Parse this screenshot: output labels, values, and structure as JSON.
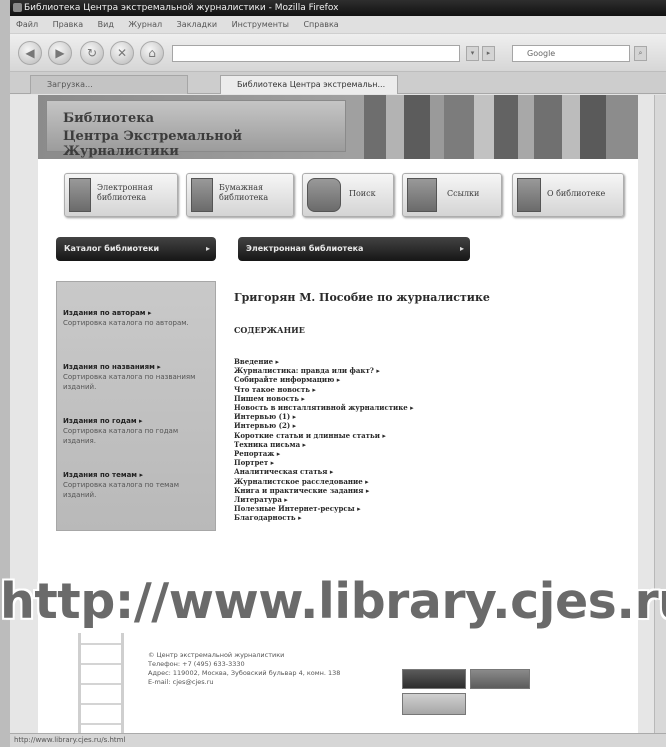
{
  "browser": {
    "window_title": "Библиотека Центра экстремальной журналистики - Mozilla Firefox",
    "menu": [
      "Файл",
      "Правка",
      "Вид",
      "Журнал",
      "Закладки",
      "Инструменты",
      "Справка"
    ],
    "address": "",
    "search_placeholder": "Google",
    "tabs": [
      {
        "label": "Загрузка..."
      },
      {
        "label": "Библиотека Центра экстремальн..."
      }
    ],
    "status_text": "http://www.library.cjes.ru/s.html"
  },
  "site": {
    "title_line1": "Библиотека",
    "title_line2": "Центра Экстремальной Журналистики",
    "nav": [
      {
        "label": "Электронная библиотека",
        "icon": "book-icon"
      },
      {
        "label": "Бумажная библиотека",
        "icon": "bookshelf-icon"
      },
      {
        "label": "Поиск",
        "icon": "scroll-icon"
      },
      {
        "label": "Ссылки",
        "icon": "signpost-icon"
      },
      {
        "label": "О библиотеке",
        "icon": "scroll-paper-icon"
      }
    ],
    "left_header": "Каталог библиотеки",
    "main_header": "Электронная библиотека",
    "sidebar": [
      {
        "title": "Издания по авторам ▸",
        "desc": "Сортировка каталога по авторам."
      },
      {
        "title": "Издания по названиям ▸",
        "desc": "Сортировка каталога по названиям изданий."
      },
      {
        "title": "Издания по годам ▸",
        "desc": "Сортировка каталога по годам издания."
      },
      {
        "title": "Издания по темам ▸",
        "desc": "Сортировка каталога по темам изданий."
      }
    ],
    "doc_title": "Григорян М. Пособие по журналистике",
    "toc_heading": "СОДЕРЖАНИЕ",
    "toc": [
      "Введение ▸",
      "Журналистика: правда или факт? ▸",
      "Собирайте информацию ▸",
      "Что такое новость ▸",
      "Пишем новость ▸",
      "Новость в инсталлятивной журналистике ▸",
      "Интервью (1) ▸",
      "Интервью (2) ▸",
      "Короткие статьи и длинные статьи ▸",
      "Техника письма ▸",
      "Репортаж ▸",
      "Портрет ▸",
      "Аналитическая статья ▸",
      "Журналистское расследование ▸",
      "Книга и практические задания ▸",
      "Литература ▸",
      "Полезные Интернет-ресурсы ▸",
      "Благодарность ▸"
    ],
    "watermark": "http://www.library.cjes.ru",
    "footer": {
      "org": "© Центр экстремальной журналистики",
      "phone": "Телефон: +7 (495) 633-3330",
      "address": "Адрес: 119002, Москва, Зубовский бульвар 4, комн. 138",
      "email": "E-mail: cjes@cjes.ru"
    }
  }
}
